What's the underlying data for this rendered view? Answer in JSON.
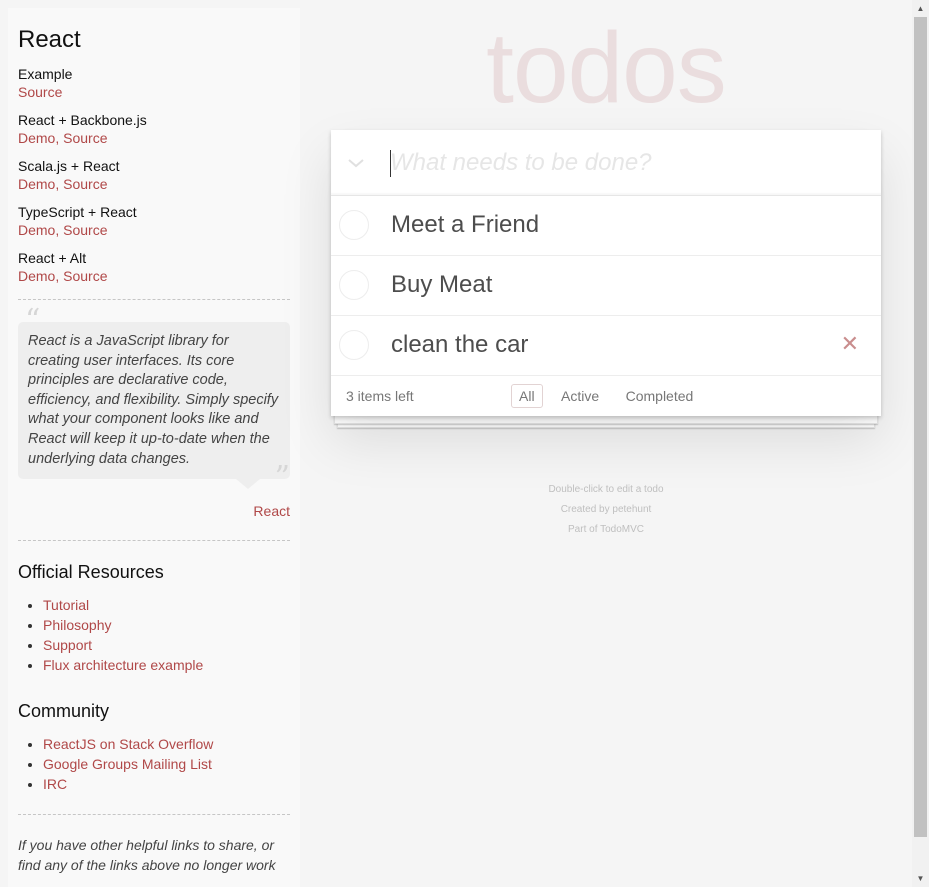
{
  "sidebar": {
    "title": "React",
    "examples": [
      {
        "title": "Example",
        "links": "Source"
      },
      {
        "title": "React + Backbone.js",
        "links": "Demo, Source"
      },
      {
        "title": "Scala.js + React",
        "links": "Demo, Source"
      },
      {
        "title": "TypeScript + React",
        "links": "Demo, Source"
      },
      {
        "title": "React + Alt",
        "links": "Demo, Source"
      }
    ],
    "quote": "React is a JavaScript library for creating user interfaces. Its core principles are declarative code, efficiency, and flexibility. Simply specify what your component looks like and React will keep it up-to-date when the underlying data changes.",
    "quote_open": "“",
    "quote_close": "”",
    "quote_attribution": "React",
    "official_resources": {
      "heading": "Official Resources",
      "items": [
        "Tutorial",
        "Philosophy",
        "Support",
        "Flux architecture example"
      ]
    },
    "community": {
      "heading": "Community",
      "items": [
        "ReactJS on Stack Overflow",
        "Google Groups Mailing List",
        "IRC"
      ]
    },
    "footer_text": "If you have other helpful links to share, or find any of the links above no longer work"
  },
  "app": {
    "title": "todos",
    "new_todo_placeholder": "What needs to be done?",
    "toggle_all_icon": "chevron-down-icon",
    "todos": [
      {
        "label": "Meet a Friend"
      },
      {
        "label": "Buy Meat"
      },
      {
        "label": "clean the car"
      }
    ],
    "items_left": "3 items left",
    "filters": [
      "All",
      "Active",
      "Completed"
    ],
    "selected_filter": "All"
  },
  "info": {
    "line1": "Double-click to edit a todo",
    "line2": "Created by petehunt",
    "line3": "Part of TodoMVC"
  },
  "colors": {
    "link": "#b04848",
    "title": "#eaddde",
    "background": "#f5f5f5"
  }
}
